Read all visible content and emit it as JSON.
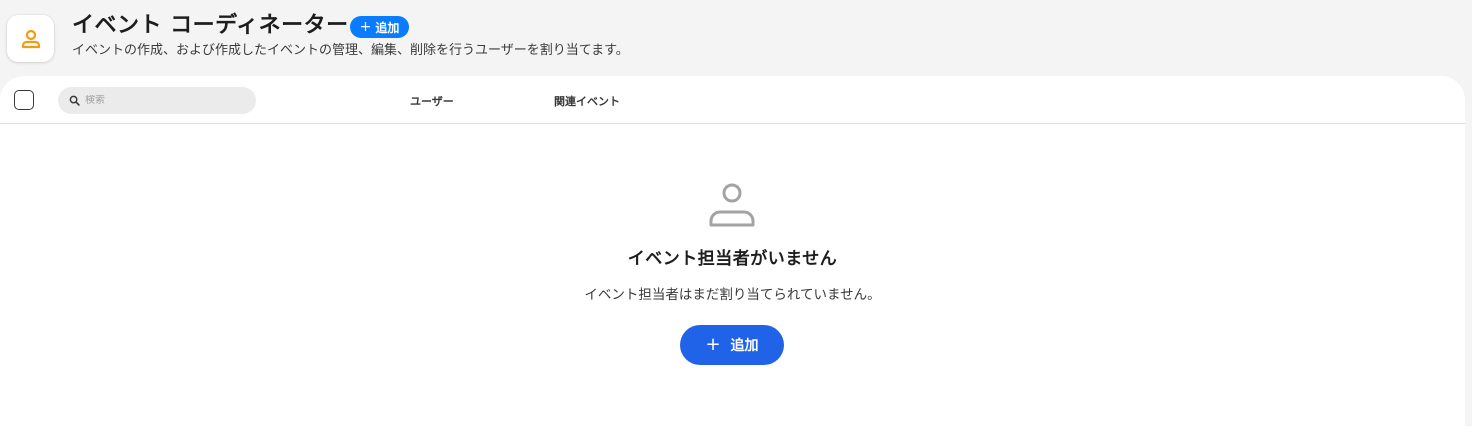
{
  "header": {
    "title": "イベント コーディネーター",
    "add_label": "追加",
    "add_icon": "plus-icon",
    "subtitle": "イベントの作成、および作成したイベントの管理、編集、削除を行うユーザーを割り当てます。",
    "app_icon": "person-icon",
    "accent_color": "#f39c12",
    "button_color": "#0a7cff"
  },
  "table": {
    "search_placeholder": "検索",
    "columns": [
      "ユーザー",
      "関連イベント"
    ]
  },
  "empty_state": {
    "icon": "person-outline-icon",
    "title": "イベント担当者がいません",
    "description": "イベント担当者はまだ割り当てられていません。",
    "add_label": "追加",
    "button_color": "#2063e8"
  }
}
